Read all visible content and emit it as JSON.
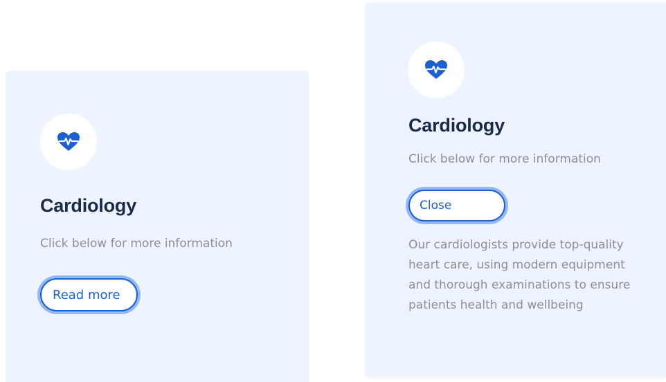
{
  "colors": {
    "card_background": "#edf4ff",
    "icon_circle": "#ffffff",
    "accent": "#1a5fd6",
    "title": "#1b2a4a",
    "muted_text": "#8a8f99"
  },
  "cards": [
    {
      "icon": "heart-pulse-icon",
      "title": "Cardiology",
      "subtitle": "Click below for more information",
      "button_label": "Read more",
      "expanded": false
    },
    {
      "icon": "heart-pulse-icon",
      "title": "Cardiology",
      "subtitle": "Click below for more information",
      "button_label": "Close",
      "expanded": true,
      "details": "Our cardiologists provide top-quality heart care, using modern equipment and thorough examinations to ensure patients health and wellbeing"
    }
  ]
}
